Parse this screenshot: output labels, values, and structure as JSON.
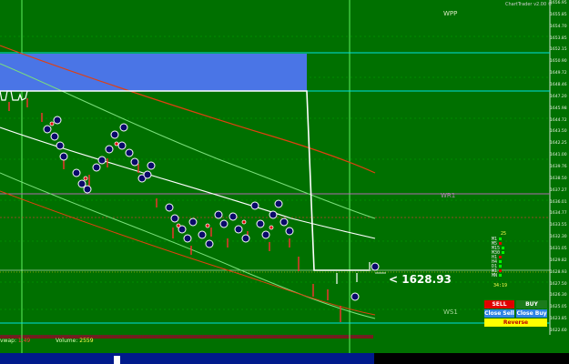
{
  "app": {
    "version_label": "ChartTrader v2.00 ©"
  },
  "colors": {
    "background": "#007000",
    "grid_green": "#00c400",
    "cyan": "#00e0e0",
    "purple": "#b06ab0",
    "blue_zone": "#4a75e6",
    "red_ma": "#e04010",
    "light_green_ma": "#7be07b",
    "white": "#ffffff"
  },
  "levels": {
    "wpp_label": "WPP",
    "wpr_label": "WR1",
    "ws1_label": "WS1"
  },
  "price": {
    "current_label": "< 1628.93"
  },
  "y_axis": [
    "1656.95",
    "1655.85",
    "1654.70",
    "1653.85",
    "1652.15",
    "1650.90",
    "1649.72",
    "1648.46",
    "1647.20",
    "1645.98",
    "1644.72",
    "1643.50",
    "1642.25",
    "1641.00",
    "1639.76",
    "1638.50",
    "1637.27",
    "1636.01",
    "1634.77",
    "1633.55",
    "1632.30",
    "1631.05",
    "1629.82",
    "1628.93",
    "1627.50",
    "1626.30",
    "1625.05",
    "1623.85",
    "1622.60"
  ],
  "signal_panel": {
    "top_value": "25",
    "rows": [
      "M1",
      "M5",
      "M15",
      "M30",
      "H1",
      "H4",
      "D1",
      "W1",
      "MN"
    ],
    "timer": "34:19"
  },
  "buttons": {
    "sell": "SELL",
    "buy": "BUY",
    "close_sell": "Close Sell",
    "close_buy": "Close Buy",
    "reverse": "Reverse"
  },
  "footer": {
    "vwap_label": "vwap:",
    "vwap_value": "1.49",
    "volume_label": "Volume:",
    "volume_value": "2559"
  }
}
